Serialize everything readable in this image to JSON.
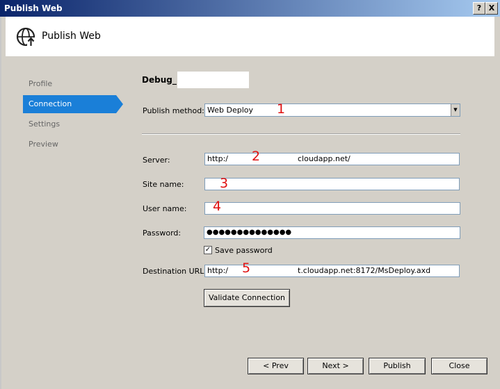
{
  "window": {
    "title": "Publish Web",
    "help_button": "?",
    "close_button": "X"
  },
  "header": {
    "title": "Publish Web",
    "icon": "globe-upload-icon"
  },
  "sidebar": {
    "items": [
      {
        "label": "Profile"
      },
      {
        "label": "Connection"
      },
      {
        "label": "Settings"
      },
      {
        "label": "Preview"
      }
    ]
  },
  "profile": {
    "name": "Debug_"
  },
  "form": {
    "publish_method_label": "Publish method:",
    "publish_method_value": "Web Deploy",
    "server_label": "Server:",
    "server_value_prefix": "http:/",
    "server_value_suffix": "cloudapp.net/",
    "site_name_label": "Site name:",
    "site_name_value": "",
    "user_name_label": "User name:",
    "user_name_value": "",
    "password_label": "Password:",
    "password_value": "●●●●●●●●●●●●●●",
    "save_password_label": "Save password",
    "save_password_checked": true,
    "destination_url_label": "Destination URL:",
    "destination_url_prefix": "http:/",
    "destination_url_suffix": "t.cloudapp.net:8172/MsDeploy.axd",
    "validate_button": "Validate Connection"
  },
  "annotations": [
    "1",
    "2",
    "3",
    "4",
    "5"
  ],
  "footer": {
    "prev": "< Prev",
    "next": "Next >",
    "publish": "Publish",
    "close": "Close"
  },
  "colors": {
    "accent": "#1a7fd8",
    "annotation": "#e01010",
    "titlebar": "#0a246a"
  }
}
